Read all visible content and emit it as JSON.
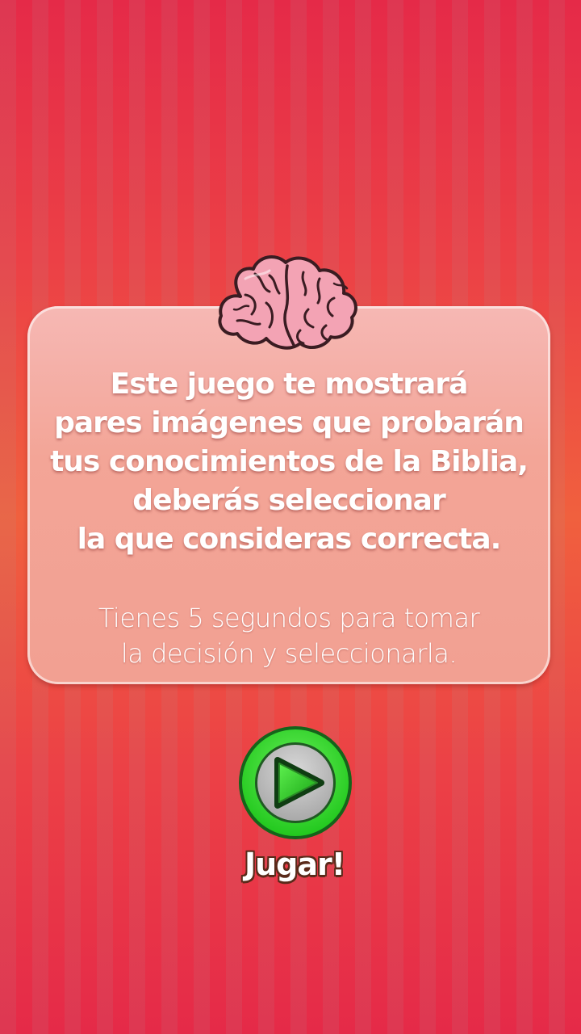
{
  "instructions": {
    "lines": [
      "Este juego te mostrará",
      "pares imágenes que probarán",
      "tus conocimientos de la Biblia,",
      "deberás seleccionar",
      "la que consideras correcta."
    ],
    "timer_lines": [
      "Tienes 5 segundos para tomar",
      "la decisión y seleccionarla."
    ]
  },
  "play": {
    "label": "Jugar!",
    "icon": "play-icon"
  },
  "colors": {
    "background_red": "#e52a48",
    "background_orange": "#f0603e",
    "panel": "#f3a597",
    "play_green": "#2fd62b",
    "play_ring": "#1a8f16"
  }
}
